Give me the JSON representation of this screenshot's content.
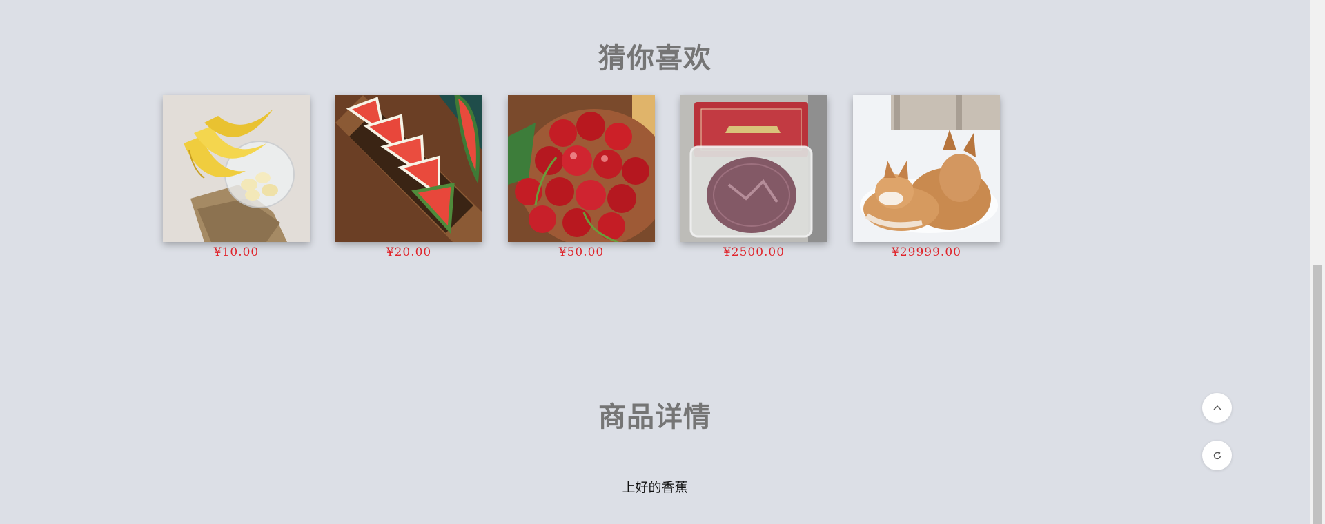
{
  "recommend": {
    "title": "猜你喜欢",
    "products": [
      {
        "name": "banana",
        "price": "¥10.00"
      },
      {
        "name": "watermelon",
        "price": "¥20.00"
      },
      {
        "name": "cherry",
        "price": "¥50.00"
      },
      {
        "name": "mooncake",
        "price": "¥2500.00"
      },
      {
        "name": "fox",
        "price": "¥29999.00"
      }
    ]
  },
  "details": {
    "title": "商品详情",
    "description": "上好的香蕉"
  },
  "float_buttons": {
    "back_to_top_icon": "chevron-up-icon",
    "refresh_icon": "refresh-icon"
  },
  "colors": {
    "background": "#dcdfe6",
    "price": "#e0262d",
    "title": "#757575"
  }
}
